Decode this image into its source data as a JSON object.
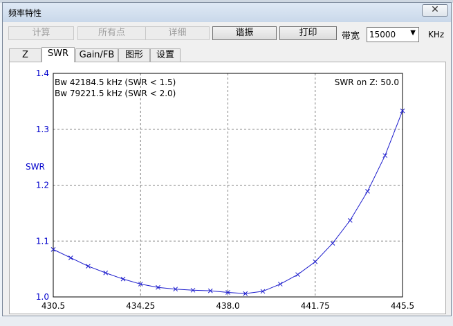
{
  "window": {
    "title": "频率特性",
    "close_glyph": "✕"
  },
  "toolbar": {
    "buttons": [
      {
        "label": "计算",
        "enabled": false
      },
      {
        "label": "所有点",
        "enabled": false
      },
      {
        "label": "详细",
        "enabled": false
      },
      {
        "label": "谐振",
        "enabled": true
      },
      {
        "label": "打印",
        "enabled": true
      }
    ],
    "bandwidth_label": "带宽",
    "bandwidth_value": "15000",
    "bandwidth_unit": "KHz",
    "dropdown_icon": "triangle-down"
  },
  "tabs": [
    {
      "label": "Z",
      "selected": false
    },
    {
      "label": "SWR",
      "selected": true
    },
    {
      "label": "Gain/FB",
      "selected": false
    },
    {
      "label": "图形",
      "selected": false
    },
    {
      "label": "设置",
      "selected": false
    }
  ],
  "colors": {
    "axis_text": "#0000cc",
    "series": "#1a1acc",
    "grid": "#7f7f7f"
  },
  "chart_data": {
    "type": "line",
    "ylabel": "SWR",
    "xlabel": "",
    "xlim": [
      430.5,
      445.5
    ],
    "ylim": [
      1.0,
      1.4
    ],
    "x_ticks": [
      "430.5",
      "434.25",
      "438.0",
      "441.75",
      "445.5"
    ],
    "y_ticks": [
      "1.0",
      "1.1",
      "1.2",
      "1.3",
      "1.4"
    ],
    "grid": true,
    "annotations": [
      "Bw 42184.5 kHz (SWR < 1.5)",
      "Bw 79221.5 kHz (SWR < 2.0)",
      "SWR on Z: 50.0"
    ],
    "series": [
      {
        "marker": "x",
        "x": [
          430.5,
          431.25,
          432.0,
          432.75,
          433.5,
          434.25,
          435.0,
          435.75,
          436.5,
          437.25,
          438.0,
          438.75,
          439.5,
          440.25,
          441.0,
          441.75,
          442.5,
          443.25,
          444.0,
          444.75,
          445.5
        ],
        "y": [
          1.085,
          1.07,
          1.055,
          1.043,
          1.032,
          1.023,
          1.017,
          1.014,
          1.012,
          1.011,
          1.008,
          1.006,
          1.01,
          1.023,
          1.04,
          1.063,
          1.096,
          1.137,
          1.189,
          1.253,
          1.333
        ]
      }
    ]
  }
}
